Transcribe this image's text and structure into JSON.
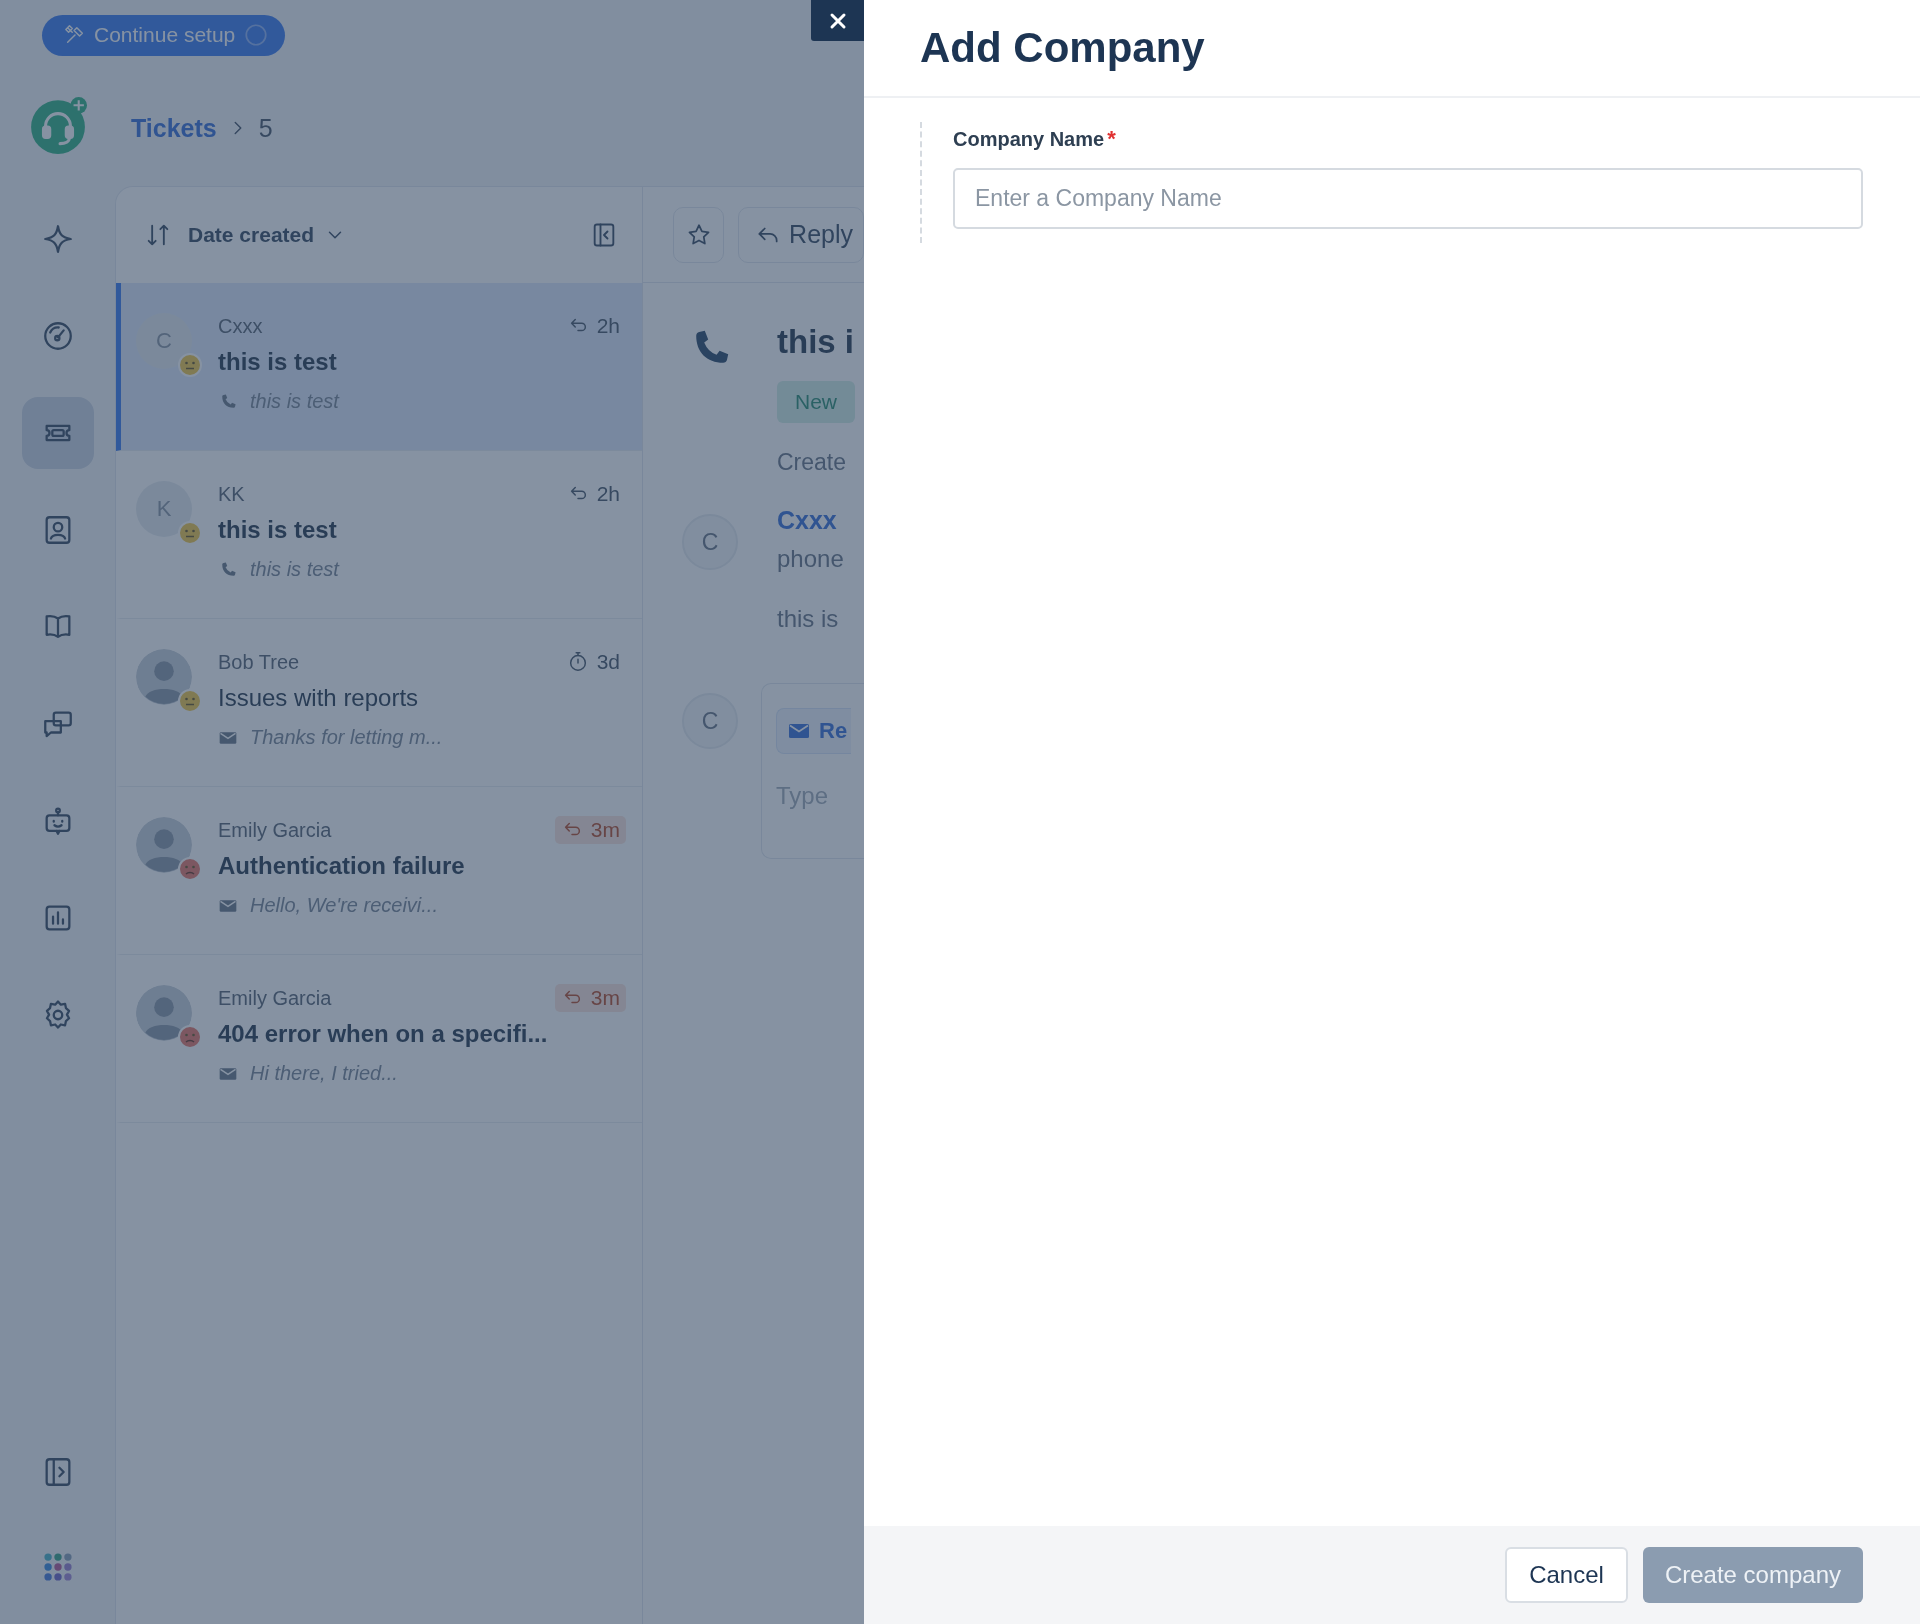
{
  "topbar": {
    "setup_button": "Continue setup"
  },
  "nav": {
    "items": [
      {
        "selected": false
      },
      {
        "selected": false
      },
      {
        "selected": true
      },
      {
        "selected": false
      },
      {
        "selected": false
      },
      {
        "selected": false
      },
      {
        "selected": false
      },
      {
        "selected": false
      },
      {
        "selected": false
      }
    ]
  },
  "breadcrumb": {
    "items": [
      "Tickets",
      "5"
    ]
  },
  "list": {
    "sort_label": "Date created",
    "tickets": [
      {
        "name": "Cxxx",
        "subject": "this is test",
        "unread": true,
        "selected": true,
        "avatar": {
          "kind": "letter",
          "initial": "C"
        },
        "upset": false,
        "time": {
          "kind": "reply",
          "text": "2h",
          "overdue": false
        },
        "preview": {
          "kind": "phone",
          "text": "this is test"
        }
      },
      {
        "name": "KK",
        "subject": "this is test",
        "unread": true,
        "selected": false,
        "avatar": {
          "kind": "letter",
          "initial": "K"
        },
        "upset": false,
        "time": {
          "kind": "reply",
          "text": "2h",
          "overdue": false
        },
        "preview": {
          "kind": "phone",
          "text": "this is test"
        }
      },
      {
        "name": "Bob Tree",
        "subject": "Issues with reports",
        "unread": false,
        "selected": false,
        "avatar": {
          "kind": "photo"
        },
        "upset": false,
        "time": {
          "kind": "timer",
          "text": "3d",
          "overdue": false
        },
        "preview": {
          "kind": "email",
          "text": "Thanks for letting m..."
        }
      },
      {
        "name": "Emily Garcia",
        "subject": "Authentication failure",
        "unread": true,
        "selected": false,
        "avatar": {
          "kind": "photo"
        },
        "upset": true,
        "time": {
          "kind": "reply",
          "text": "3m",
          "overdue": true
        },
        "preview": {
          "kind": "email",
          "text": "Hello, We're receivi..."
        }
      },
      {
        "name": "Emily Garcia",
        "subject": "404 error when on a specifi...",
        "unread": true,
        "selected": false,
        "avatar": {
          "kind": "photo"
        },
        "upset": true,
        "time": {
          "kind": "reply",
          "text": "3m",
          "overdue": true
        },
        "preview": {
          "kind": "email",
          "text": "Hi there, I tried..."
        }
      }
    ]
  },
  "detail": {
    "reply_button": "Reply",
    "title": "this i",
    "status": "New",
    "created": "Create",
    "message": {
      "avatar": "C",
      "author": "Cxxx",
      "lines": [
        "phone",
        "this is"
      ]
    },
    "composer": {
      "avatar": "C",
      "reply_tab": "Re",
      "placeholder": "Type"
    }
  },
  "drawer": {
    "title": "Add Company",
    "field": {
      "label": "Company Name",
      "required_mark": "*",
      "placeholder": "Enter a Company Name"
    },
    "buttons": [
      {
        "label": "Cancel",
        "kind": "secondary",
        "disabled": false
      },
      {
        "label": "Create company",
        "kind": "primary",
        "disabled": true
      }
    ]
  }
}
